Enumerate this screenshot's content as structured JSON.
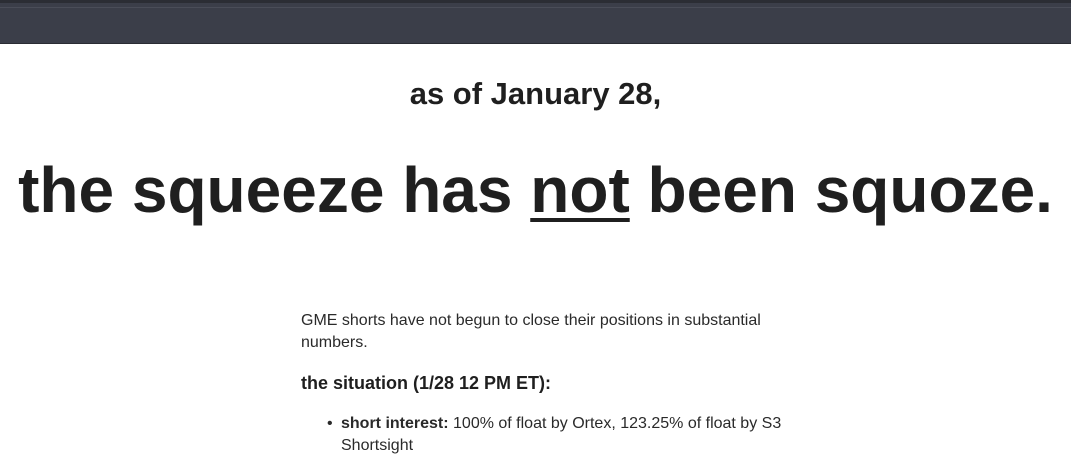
{
  "header": {
    "subtitle": "as of January 28,",
    "headline_before": "the squeeze has ",
    "headline_emphasis": "not",
    "headline_after": " been squoze."
  },
  "content": {
    "intro": "GME shorts have not begun to close their positions in substantial numbers.",
    "situation_heading": "the situation (1/28 12 PM ET):",
    "bullets": [
      {
        "label": "short interest:",
        "text": " 100% of float by Ortex, 123.25% of float by S3 Shortsight"
      }
    ]
  }
}
